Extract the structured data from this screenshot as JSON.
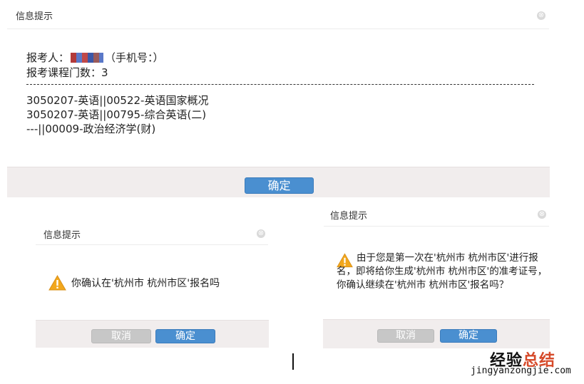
{
  "top_dialog": {
    "title": "信息提示",
    "close_glyph": "⊗",
    "examinee_prefix": "报考人：",
    "examinee_suffix": "（手机号：）",
    "course_count_label": "报考课程门数：3",
    "courses": [
      "3050207-英语||00522-英语国家概况",
      "3050207-英语||00795-综合英语(二)",
      "---||00009-政治经济学(财)"
    ],
    "ok_label": "确定"
  },
  "confirm_left": {
    "title": "信息提示",
    "close_glyph": "⊗",
    "message": "你确认在'杭州市 杭州市区'报名吗",
    "cancel_label": "取消",
    "ok_label": "确定"
  },
  "confirm_right": {
    "title": "信息提示",
    "close_glyph": "⊗",
    "message": "由于您是第一次在'杭州市 杭州市区'进行报名，即将给你生成'杭州市 杭州市区'的准考证号，你确认继续在'杭州市 杭州市区'报名吗？",
    "cancel_label": "取消",
    "ok_label": "确定"
  },
  "watermark": {
    "brand_a": "经验",
    "brand_b": "总结",
    "url": "jingyanzongjie.com"
  },
  "colors": {
    "primary_button": "#4a8fd0",
    "muted_button": "#c7c7c7",
    "footer_bg": "#f1eded",
    "warning_icon": "#f2a71c"
  },
  "icons": {
    "warning": "warning-triangle-icon",
    "close": "close-circle-icon"
  }
}
